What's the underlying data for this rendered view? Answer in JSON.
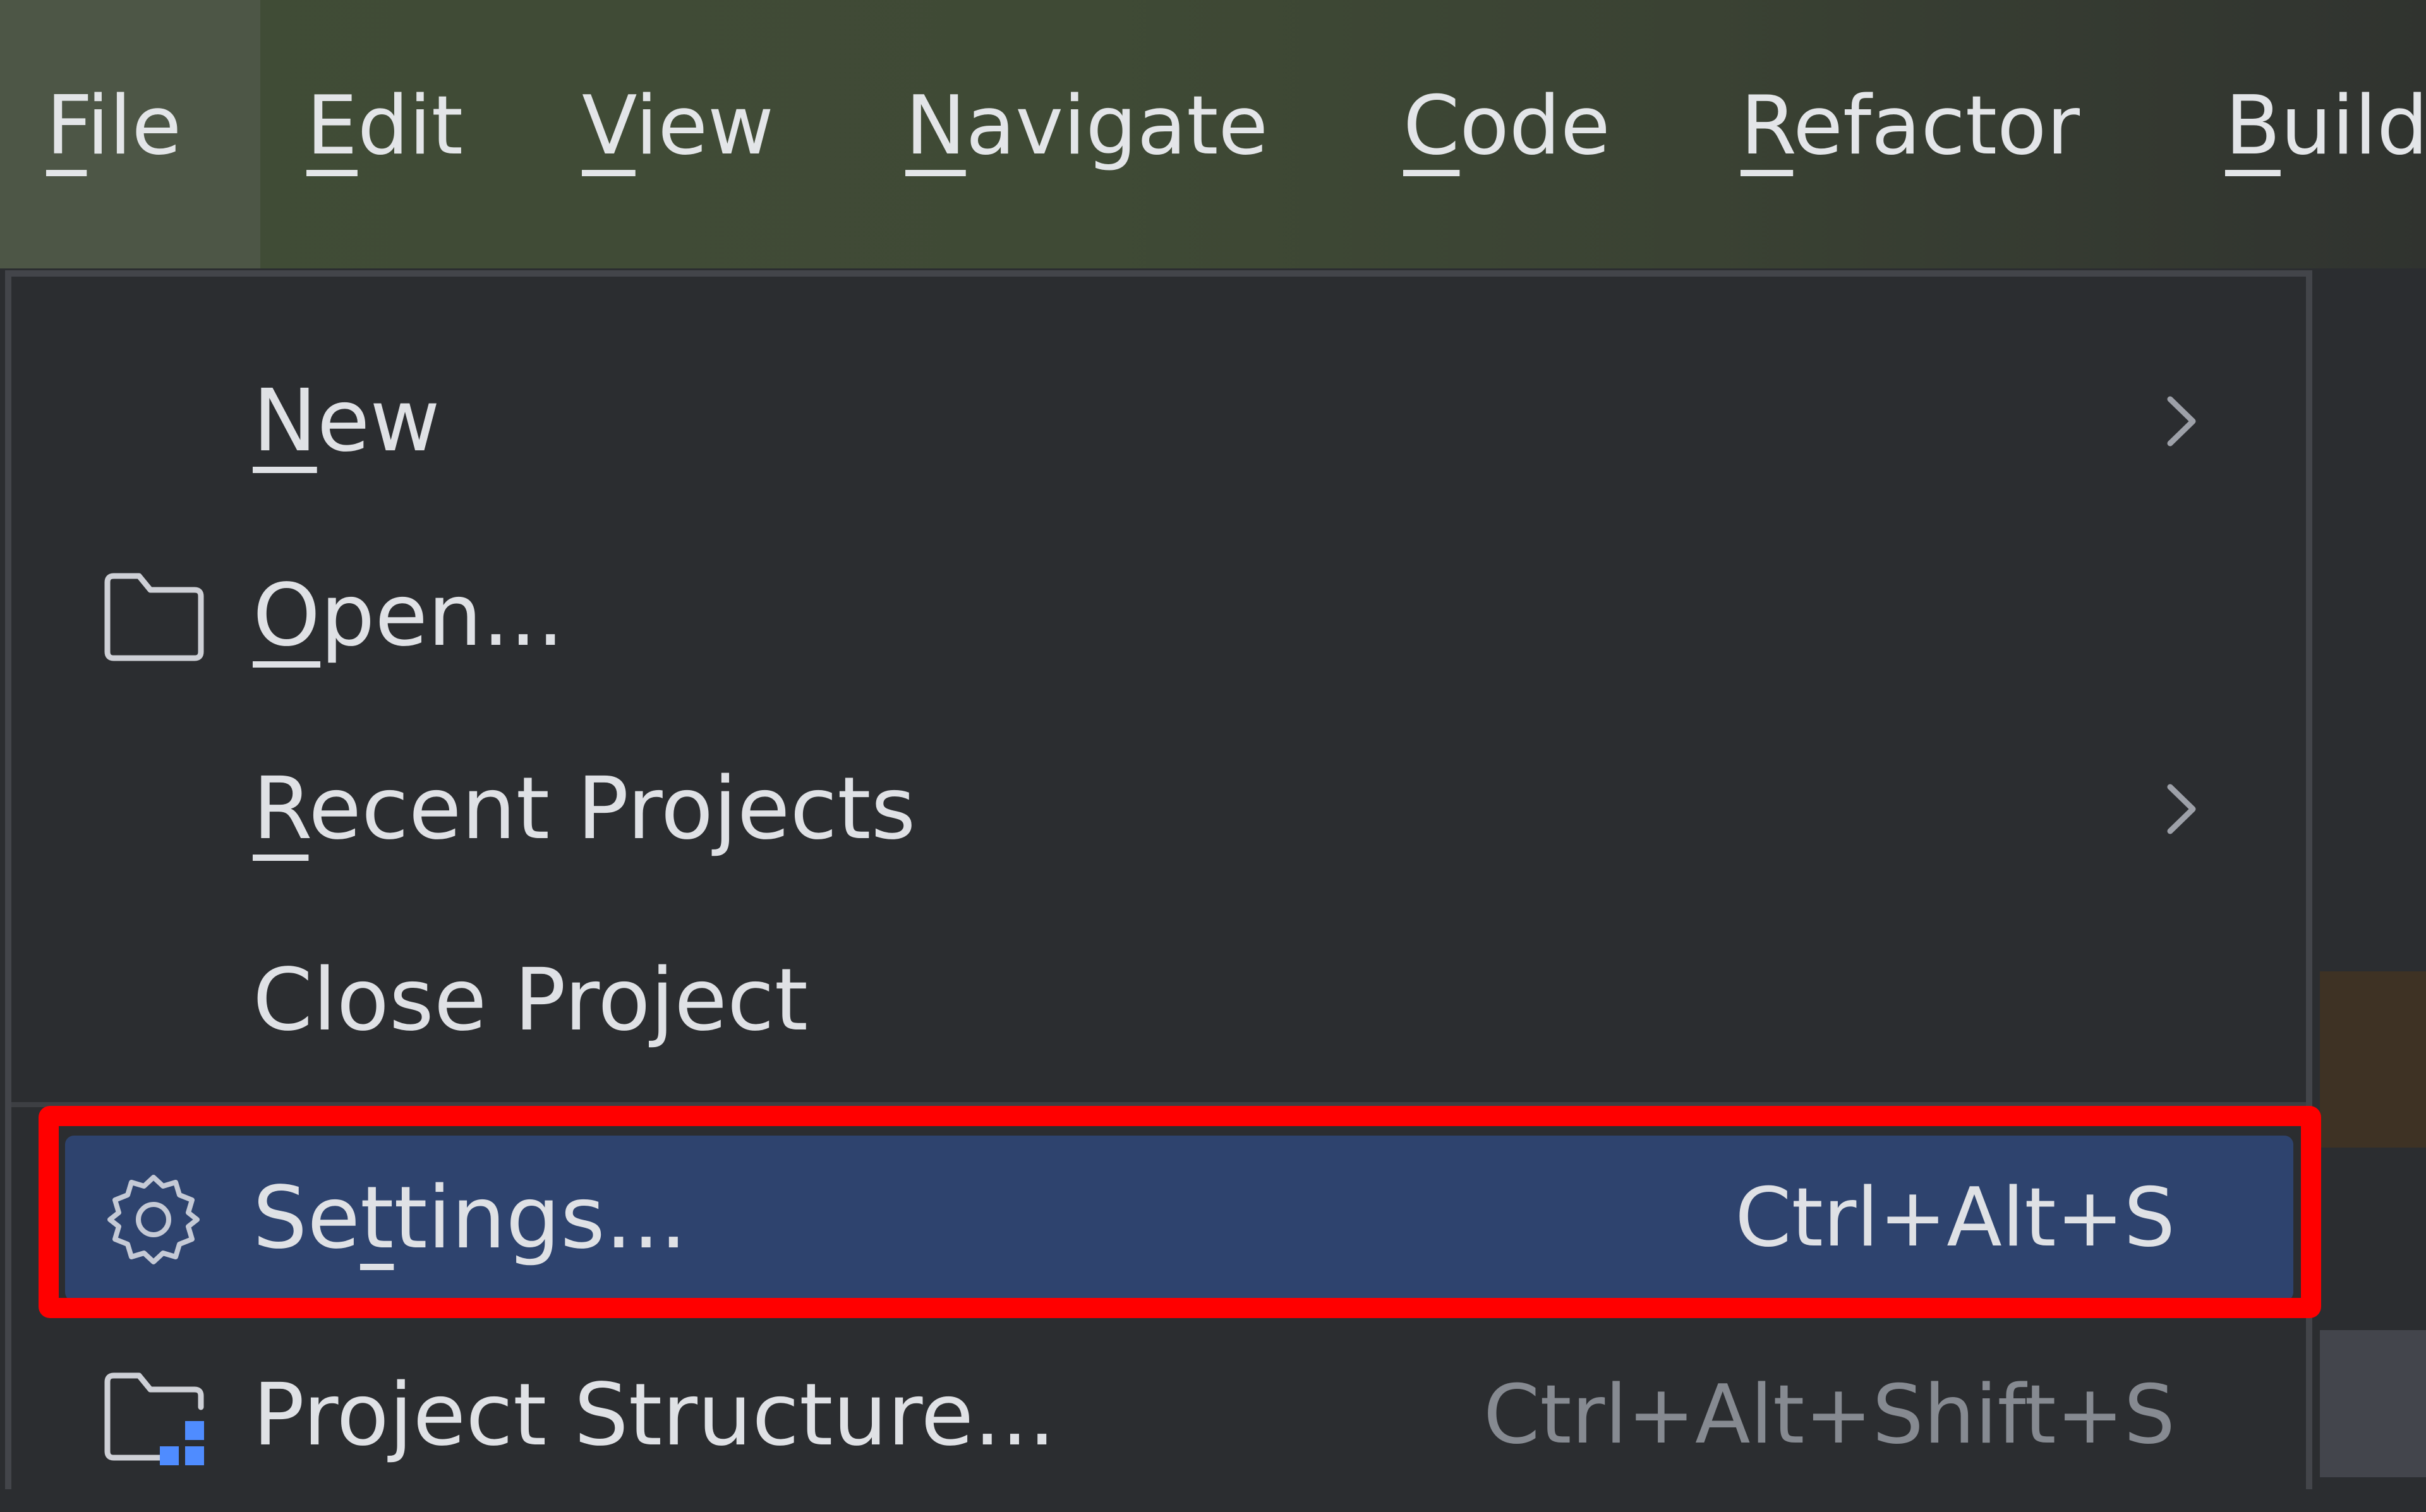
{
  "menubar": {
    "items": [
      {
        "label": "File",
        "mnemonic_index": 0,
        "active": true
      },
      {
        "label": "Edit",
        "mnemonic_index": 0,
        "active": false
      },
      {
        "label": "View",
        "mnemonic_index": 0,
        "active": false
      },
      {
        "label": "Navigate",
        "mnemonic_index": 0,
        "active": false
      },
      {
        "label": "Code",
        "mnemonic_index": 0,
        "active": false
      },
      {
        "label": "Refactor",
        "mnemonic_index": 0,
        "active": false
      },
      {
        "label": "Build",
        "mnemonic_index": 0,
        "active": false
      }
    ]
  },
  "file_menu": {
    "items": [
      {
        "label": "New",
        "mnemonic_index": 0,
        "icon": null,
        "submenu": true,
        "shortcut": ""
      },
      {
        "label": "Open...",
        "mnemonic_index": 0,
        "icon": "folder-icon",
        "submenu": false,
        "shortcut": ""
      },
      {
        "label": "Recent Projects",
        "mnemonic_index": 0,
        "icon": null,
        "submenu": true,
        "shortcut": ""
      },
      {
        "label": "Close Project",
        "mnemonic_index": -1,
        "icon": null,
        "submenu": false,
        "shortcut": ""
      },
      {
        "label": "Settings...",
        "mnemonic_index": 2,
        "icon": "gear-icon",
        "submenu": false,
        "shortcut": "Ctrl+Alt+S",
        "selected": true,
        "annotated": true
      },
      {
        "label": "Project Structure...",
        "mnemonic_index": -1,
        "icon": "project-structure-icon",
        "submenu": false,
        "shortcut": "Ctrl+Alt+Shift+S"
      }
    ]
  },
  "colors": {
    "menubar_bg": "#3f4a35",
    "menubar_active": "#4d5646",
    "popup_bg": "#2b2d30",
    "selection_bg": "#2e436e",
    "annotation_red": "#ff0000",
    "icon_accent_blue": "#4f8cff"
  }
}
